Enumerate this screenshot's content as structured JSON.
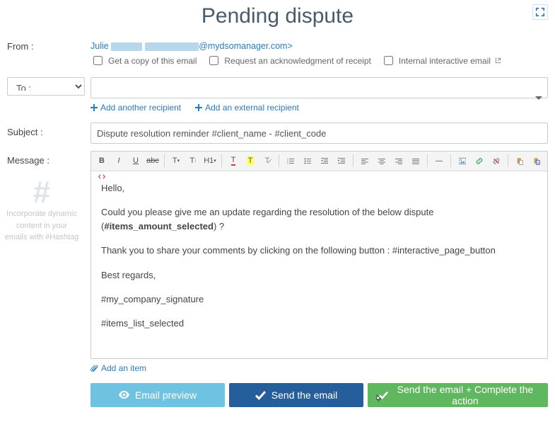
{
  "title": "Pending dispute",
  "labels": {
    "from": "From :",
    "to": "To :",
    "subject": "Subject :",
    "message": "Message :"
  },
  "from": {
    "name": "Julie",
    "domain": "@mydsomanager.com>"
  },
  "checks": {
    "copy": "Get a copy of this email",
    "receipt": "Request an acknowledgment of receipt",
    "internal": "Internal interactive email"
  },
  "addlinks": {
    "another": "Add another recipient",
    "external": "Add an external recipient"
  },
  "subject_value": "Dispute resolution reminder #client_name - #client_code",
  "hash_hint": "Incorporate dynamic content in your emails with #Hashtag",
  "body": {
    "hello": "Hello,",
    "p1a": "Could you please give me an update regarding the resolution of the below dispute (",
    "p1b": "#items_amount_selected",
    "p1c": ") ?",
    "p2": "Thank you to share your comments by clicking on the following button : #interactive_page_button",
    "p3": "Best regards,",
    "p4": "#my_company_signature",
    "p5": "#items_list_selected"
  },
  "add_item": "Add an item",
  "buttons": {
    "preview": "Email preview",
    "send": "Send the email",
    "send_complete": "Send the email + Complete the action"
  }
}
